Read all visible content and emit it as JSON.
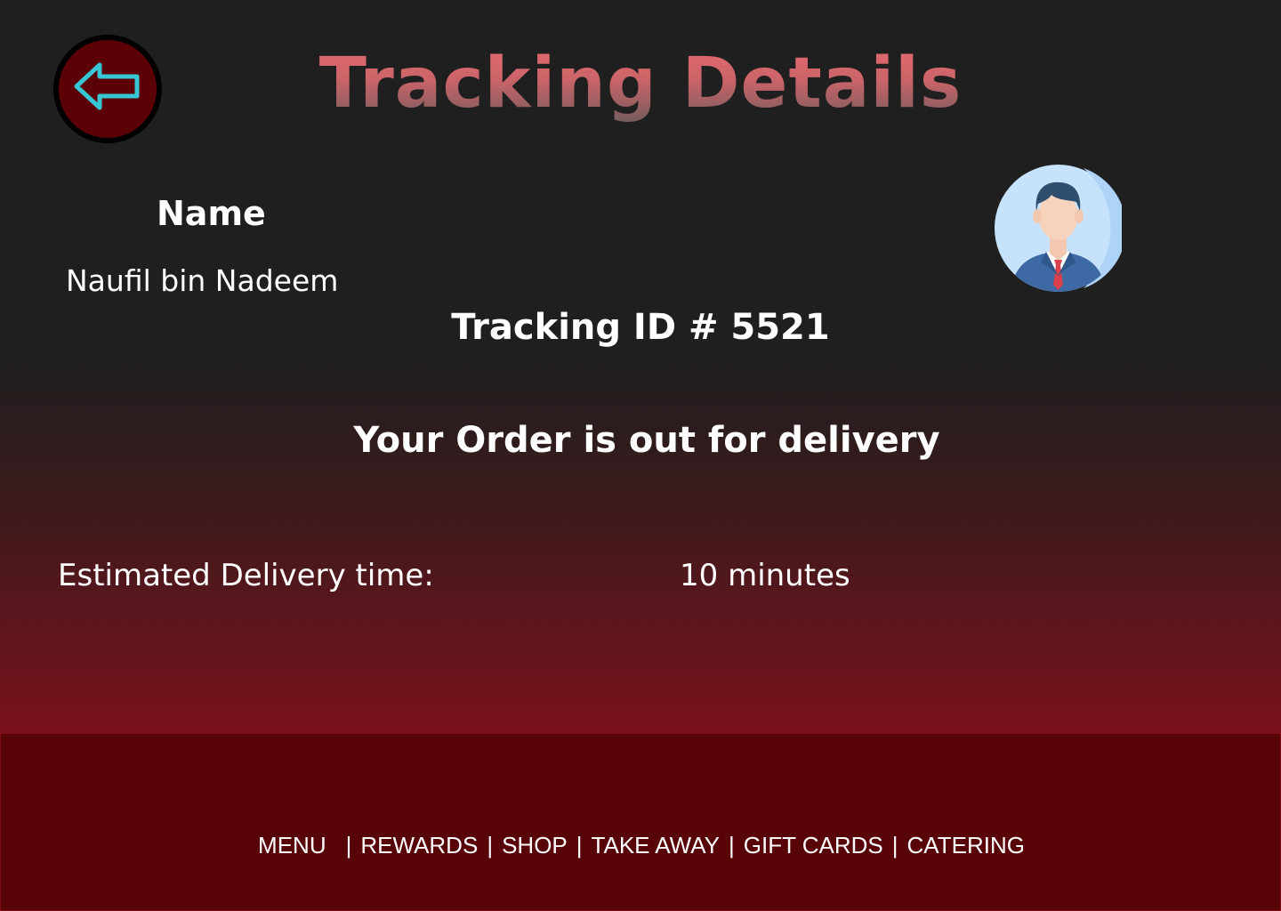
{
  "header": {
    "title": "Tracking Details",
    "back_icon": "arrow-left-icon",
    "back_icon_color": "#37c6d4",
    "back_button_color": "#5c0008"
  },
  "profile": {
    "name_label": "Name",
    "name_value": "Naufil bin Nadeem",
    "avatar_icon": "businessman-avatar-icon"
  },
  "tracking": {
    "id_text": "Tracking ID # 5521",
    "status": "Your Order is out for delivery",
    "eta_label": "Estimated Delivery time:",
    "eta_value": "10 minutes"
  },
  "footer": {
    "background": "#570308",
    "nav": [
      {
        "label": "MENU"
      },
      {
        "label": "REWARDS"
      },
      {
        "label": "SHOP"
      },
      {
        "label": "TAKE AWAY"
      },
      {
        "label": "GIFT CARDS"
      },
      {
        "label": "CATERING"
      }
    ],
    "separator": "|"
  }
}
